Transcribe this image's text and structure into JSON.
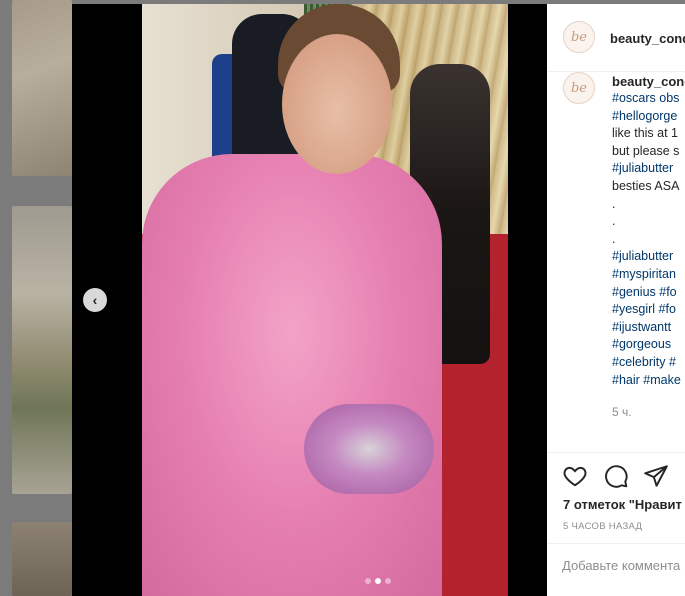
{
  "post": {
    "username": "beauty_cond",
    "avatar_text": "be",
    "caption_user": "beauty_cond",
    "caption_lines": [
      {
        "text": "#oscars obs",
        "tag": true
      },
      {
        "text": "#hellogorge",
        "tag": true
      },
      {
        "text": "like this at 1",
        "tag": false
      },
      {
        "text": "but please s",
        "tag": false
      },
      {
        "text": "#juliabutter",
        "tag": true
      },
      {
        "text": "besties ASA",
        "tag": false
      },
      {
        "text": ".",
        "tag": false
      },
      {
        "text": ".",
        "tag": false
      },
      {
        "text": ".",
        "tag": false
      },
      {
        "text": "#juliabutter",
        "tag": true
      },
      {
        "text": "#myspiritan",
        "tag": true
      },
      {
        "text": "#genius #fo",
        "tag": true
      },
      {
        "text": "#yesgirl #fo",
        "tag": true
      },
      {
        "text": "#ijustwantt",
        "tag": true
      },
      {
        "text": "#gorgeous",
        "tag": true
      },
      {
        "text": "#celebrity #",
        "tag": true
      },
      {
        "text": "#hair #make",
        "tag": true
      }
    ],
    "caption_age": "5 ч.",
    "likes_text": "7 отметок \"Нравит",
    "time_text": "5 ЧАСОВ НАЗАД",
    "comment_placeholder": "Добавьте коммента",
    "carousel": {
      "count": 3,
      "active": 1
    }
  },
  "icons": {
    "prev": "chevron-left-icon",
    "like": "heart-icon",
    "comment": "speech-bubble-icon",
    "share": "paper-plane-icon"
  },
  "colors": {
    "link_hashtag": "#00376b",
    "text": "#262626",
    "muted": "#8e8e8e",
    "dress_pink": "#e67fb1",
    "carpet_red": "#b3222d"
  }
}
